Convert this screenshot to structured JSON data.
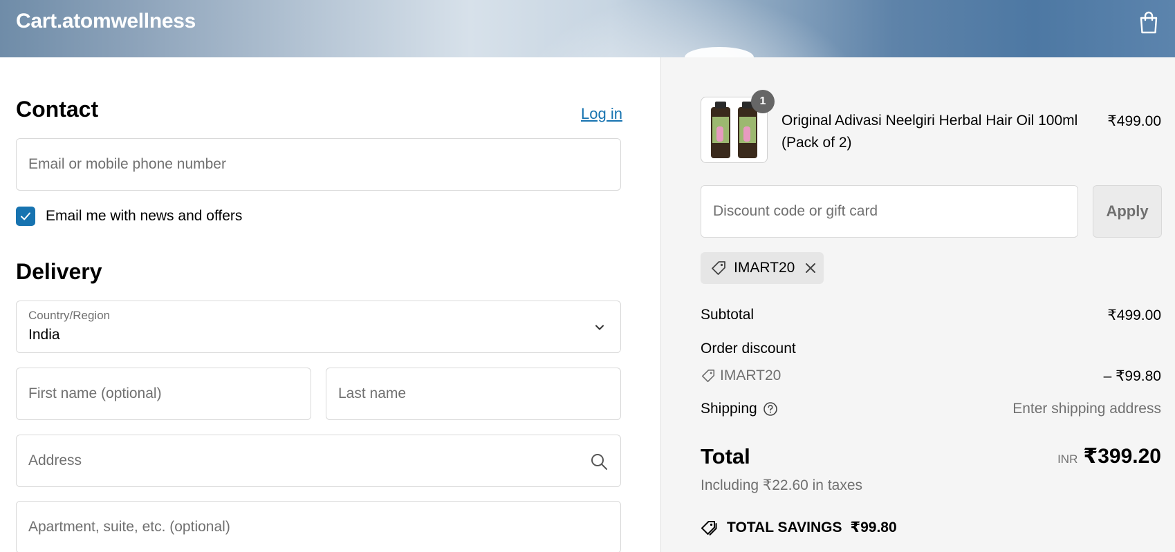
{
  "header": {
    "brand": "Cart.atomwellness",
    "cart_icon": "shopping-bag-icon"
  },
  "contact": {
    "title": "Contact",
    "login_label": "Log in",
    "email_placeholder": "Email or mobile phone number",
    "newsletter_label": "Email me with news and offers",
    "newsletter_checked": true
  },
  "delivery": {
    "title": "Delivery",
    "country_label": "Country/Region",
    "country_value": "India",
    "first_name_placeholder": "First name (optional)",
    "last_name_placeholder": "Last name",
    "address_placeholder": "Address",
    "apartment_placeholder": "Apartment, suite, etc. (optional)"
  },
  "summary": {
    "item": {
      "quantity": "1",
      "name": "Original Adivasi Neelgiri Herbal Hair Oil 100ml (Pack of 2)",
      "price": "₹499.00"
    },
    "discount_placeholder": "Discount code or gift card",
    "apply_label": "Apply",
    "applied_code": "IMART20",
    "subtotal_label": "Subtotal",
    "subtotal_value": "₹499.00",
    "order_discount_label": "Order discount",
    "discount_code": "IMART20",
    "discount_value": "– ₹99.80",
    "shipping_label": "Shipping",
    "shipping_value": "Enter shipping address",
    "total_label": "Total",
    "currency": "INR",
    "total_value": "₹399.20",
    "tax_text": "Including ₹22.60 in taxes",
    "savings_label": "TOTAL SAVINGS",
    "savings_value": "₹99.80"
  },
  "colors": {
    "accent": "#1773b0",
    "summary_bg": "#f5f5f5"
  }
}
